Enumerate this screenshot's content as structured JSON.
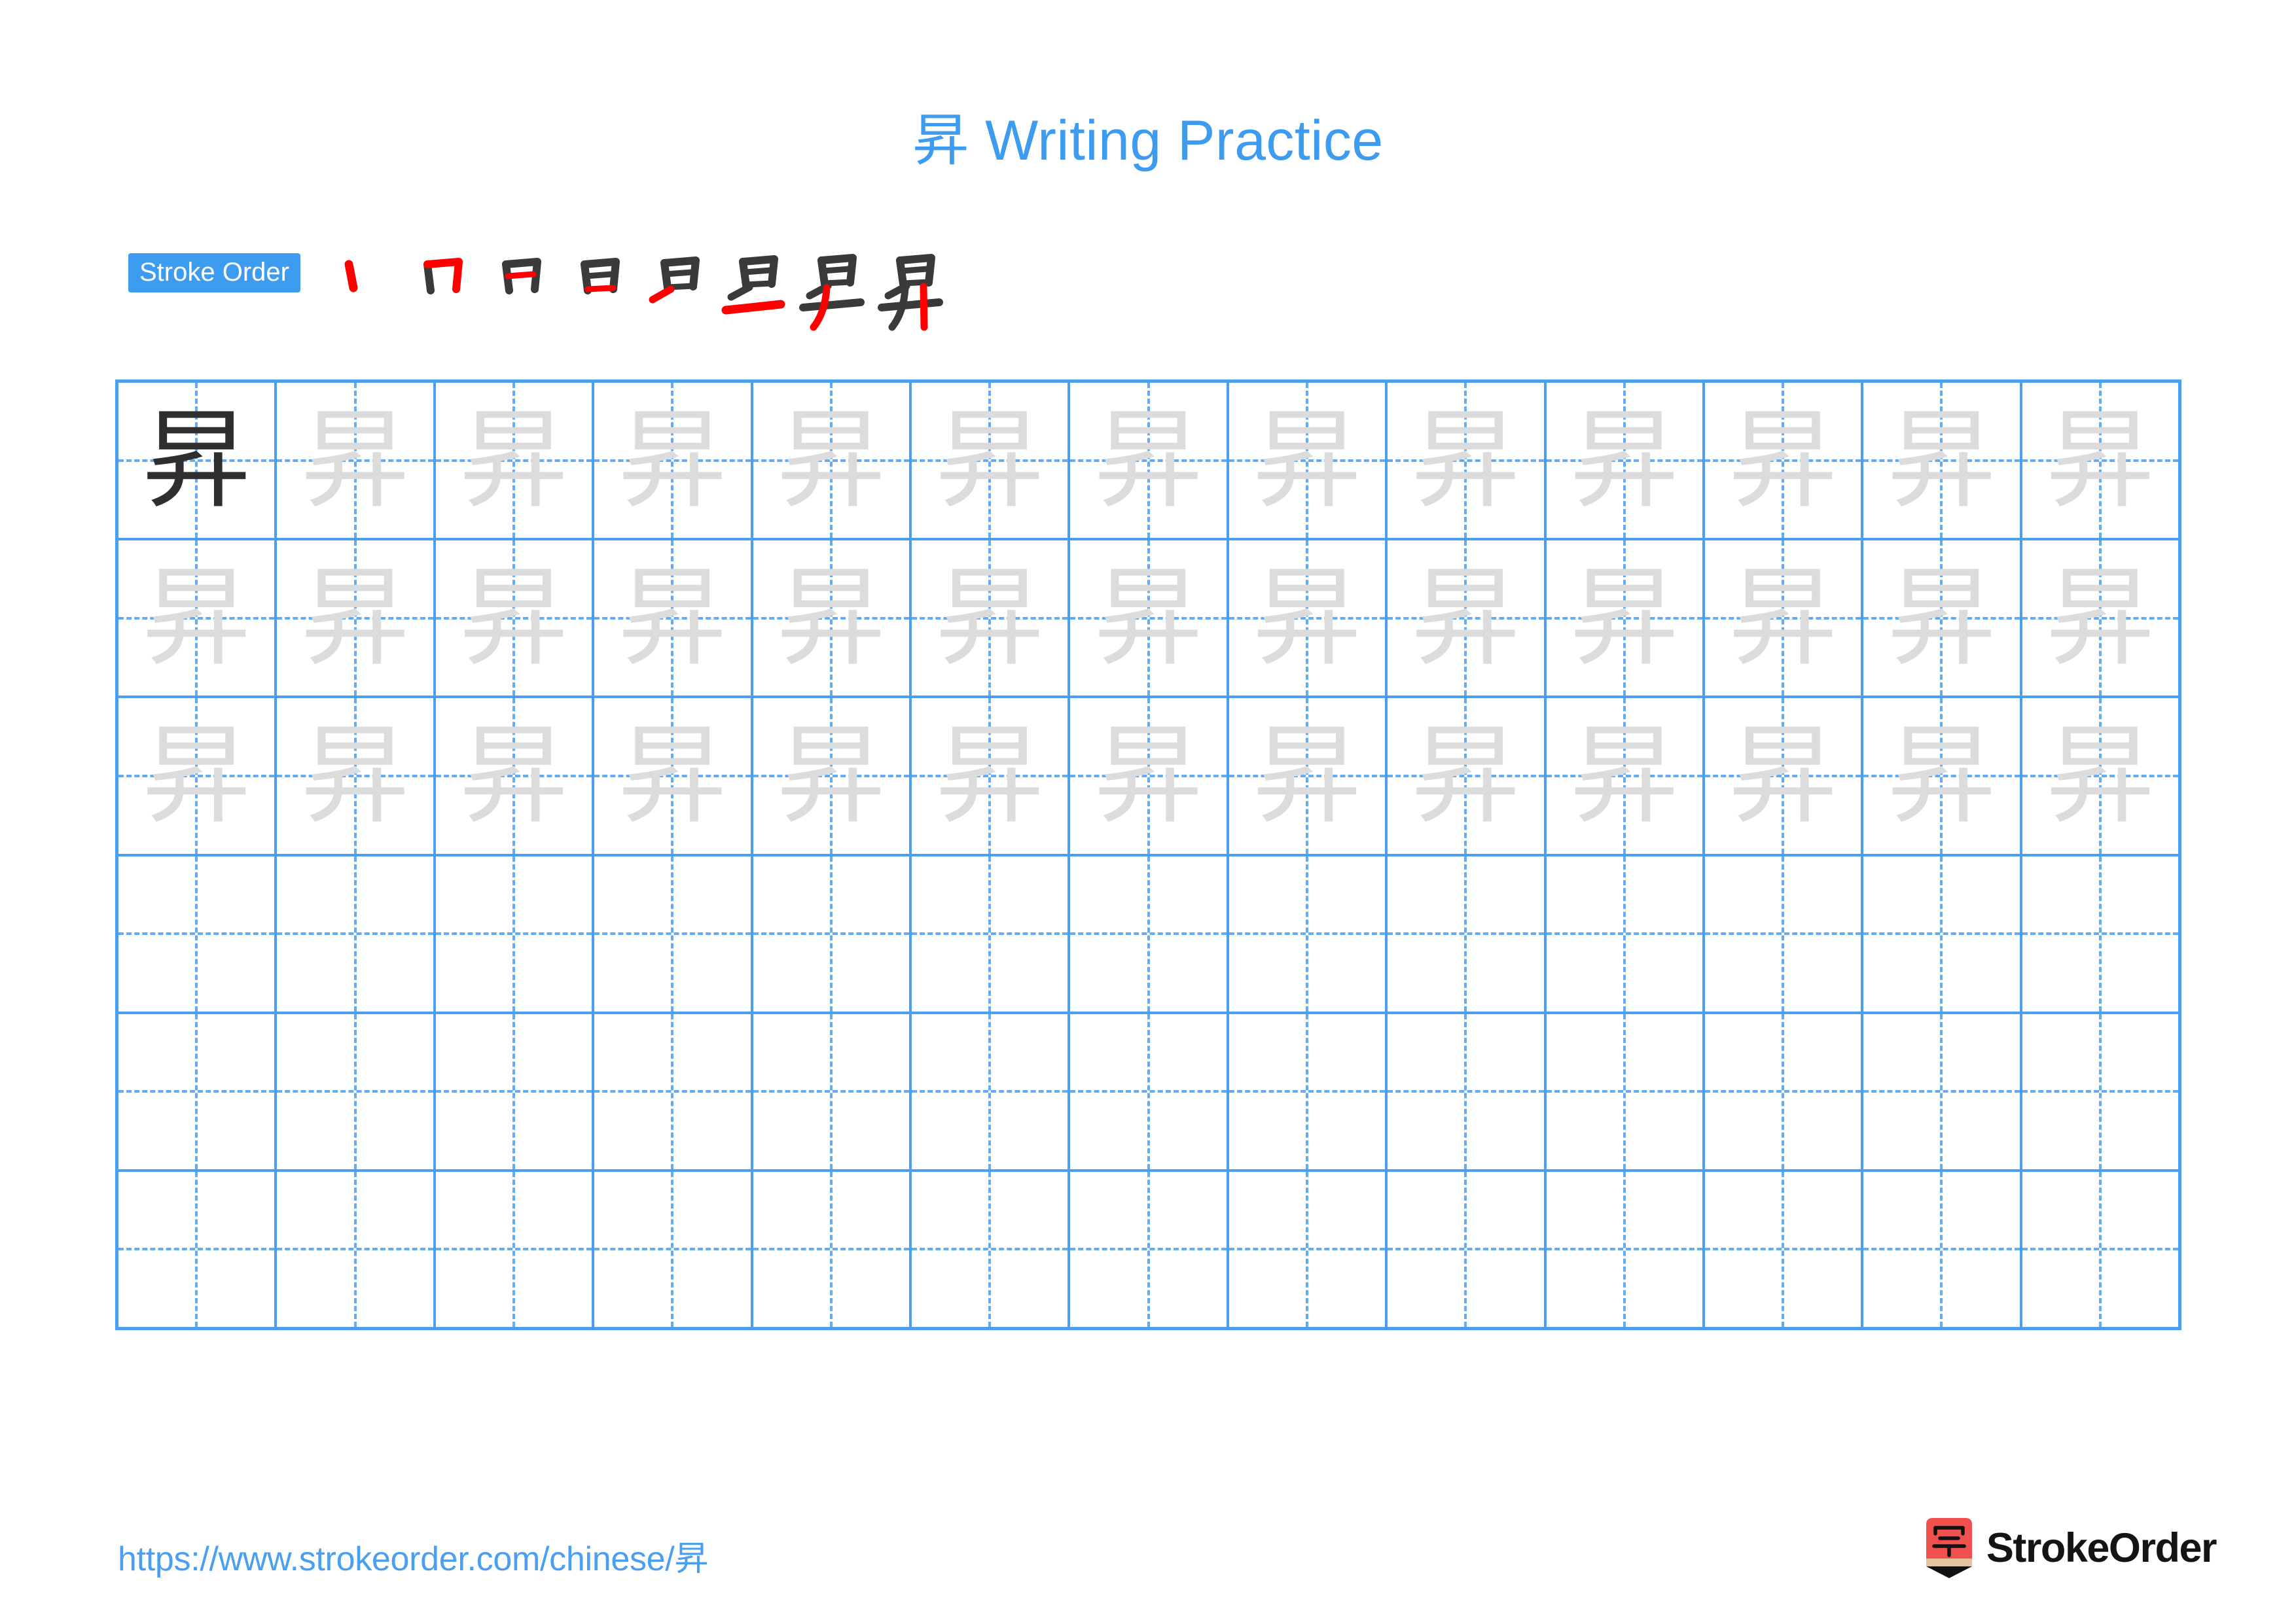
{
  "document": {
    "character": "昇",
    "title": "昇 Writing Practice",
    "accent_color": "#3d9bf0",
    "grid_line_color": "#4a9ff0",
    "guide_line_color": "#63acf2",
    "trace_color": "#dcdcdc",
    "ink_color": "#2f2f2f",
    "highlight_stroke_color": "#ff0000"
  },
  "stroke_order": {
    "label": "Stroke Order",
    "total_strokes": 8,
    "steps": [
      {
        "index": 1,
        "glyph": "丿",
        "new_stroke": "left-falling-dot"
      },
      {
        "index": 2,
        "glyph": "冂",
        "new_stroke": "horizontal-then-vertical-hook"
      },
      {
        "index": 3,
        "glyph": "日",
        "new_stroke": "inner-horizontal"
      },
      {
        "index": 4,
        "glyph": "日",
        "new_stroke": "bottom-horizontal"
      },
      {
        "index": 5,
        "glyph": "𠃌",
        "new_stroke": "left-short-slant"
      },
      {
        "index": 6,
        "glyph": "旦",
        "new_stroke": "long-horizontal"
      },
      {
        "index": 7,
        "glyph": "昇",
        "new_stroke": "left-falling-sweep"
      },
      {
        "index": 8,
        "glyph": "昇",
        "new_stroke": "final-vertical"
      }
    ]
  },
  "practice_grid": {
    "columns": 13,
    "rows": 6,
    "rows_data": [
      {
        "row": 1,
        "cells": [
          "昇",
          "昇",
          "昇",
          "昇",
          "昇",
          "昇",
          "昇",
          "昇",
          "昇",
          "昇",
          "昇",
          "昇",
          "昇"
        ],
        "styles": [
          "dark",
          "light",
          "light",
          "light",
          "light",
          "light",
          "light",
          "light",
          "light",
          "light",
          "light",
          "light",
          "light"
        ]
      },
      {
        "row": 2,
        "cells": [
          "昇",
          "昇",
          "昇",
          "昇",
          "昇",
          "昇",
          "昇",
          "昇",
          "昇",
          "昇",
          "昇",
          "昇",
          "昇"
        ],
        "styles": [
          "light",
          "light",
          "light",
          "light",
          "light",
          "light",
          "light",
          "light",
          "light",
          "light",
          "light",
          "light",
          "light"
        ]
      },
      {
        "row": 3,
        "cells": [
          "昇",
          "昇",
          "昇",
          "昇",
          "昇",
          "昇",
          "昇",
          "昇",
          "昇",
          "昇",
          "昇",
          "昇",
          "昇"
        ],
        "styles": [
          "light",
          "light",
          "light",
          "light",
          "light",
          "light",
          "light",
          "light",
          "light",
          "light",
          "light",
          "light",
          "light"
        ]
      },
      {
        "row": 4,
        "cells": [
          "",
          "",
          "",
          "",
          "",
          "",
          "",
          "",
          "",
          "",
          "",
          "",
          ""
        ],
        "styles": [
          "empty",
          "empty",
          "empty",
          "empty",
          "empty",
          "empty",
          "empty",
          "empty",
          "empty",
          "empty",
          "empty",
          "empty",
          "empty"
        ]
      },
      {
        "row": 5,
        "cells": [
          "",
          "",
          "",
          "",
          "",
          "",
          "",
          "",
          "",
          "",
          "",
          "",
          ""
        ],
        "styles": [
          "empty",
          "empty",
          "empty",
          "empty",
          "empty",
          "empty",
          "empty",
          "empty",
          "empty",
          "empty",
          "empty",
          "empty",
          "empty"
        ]
      },
      {
        "row": 6,
        "cells": [
          "",
          "",
          "",
          "",
          "",
          "",
          "",
          "",
          "",
          "",
          "",
          "",
          ""
        ],
        "styles": [
          "empty",
          "empty",
          "empty",
          "empty",
          "empty",
          "empty",
          "empty",
          "empty",
          "empty",
          "empty",
          "empty",
          "empty",
          "empty"
        ]
      }
    ]
  },
  "footer": {
    "url": "https://www.strokeorder.com/chinese/昇",
    "logo_text": "StrokeOrder",
    "logo_glyph": "字",
    "logo_body_color": "#f0514f",
    "logo_wood_color": "#e3c4a0",
    "logo_tip_color": "#111111"
  }
}
